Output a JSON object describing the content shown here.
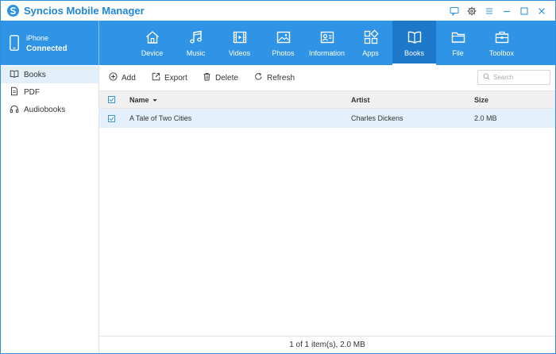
{
  "app": {
    "title": "Syncios Mobile Manager",
    "accent": "#2f93e6"
  },
  "device": {
    "name": "iPhone",
    "status": "Connected"
  },
  "nav": {
    "items": [
      {
        "label": "Device",
        "icon": "home-icon"
      },
      {
        "label": "Music",
        "icon": "music-icon"
      },
      {
        "label": "Videos",
        "icon": "film-icon"
      },
      {
        "label": "Photos",
        "icon": "image-icon"
      },
      {
        "label": "Information",
        "icon": "contact-card-icon"
      },
      {
        "label": "Apps",
        "icon": "apps-grid-icon"
      },
      {
        "label": "Books",
        "icon": "book-icon"
      },
      {
        "label": "File",
        "icon": "folder-icon"
      },
      {
        "label": "Toolbox",
        "icon": "toolbox-icon"
      }
    ],
    "active": "Books"
  },
  "sidebar": {
    "items": [
      {
        "label": "Books",
        "icon": "book-icon",
        "active": true
      },
      {
        "label": "PDF",
        "icon": "document-icon",
        "active": false
      },
      {
        "label": "Audiobooks",
        "icon": "headphones-icon",
        "active": false
      }
    ]
  },
  "actions": {
    "add": "Add",
    "export": "Export",
    "delete": "Delete",
    "refresh": "Refresh",
    "search_placeholder": "Search"
  },
  "table": {
    "columns": {
      "name": "Name",
      "artist": "Artist",
      "size": "Size"
    },
    "rows": [
      {
        "name": "A Tale of Two Cities",
        "artist": "Charles Dickens",
        "size": "2.0 MB",
        "checked": true
      }
    ]
  },
  "status": {
    "text": "1 of 1 item(s), 2.0 MB"
  }
}
